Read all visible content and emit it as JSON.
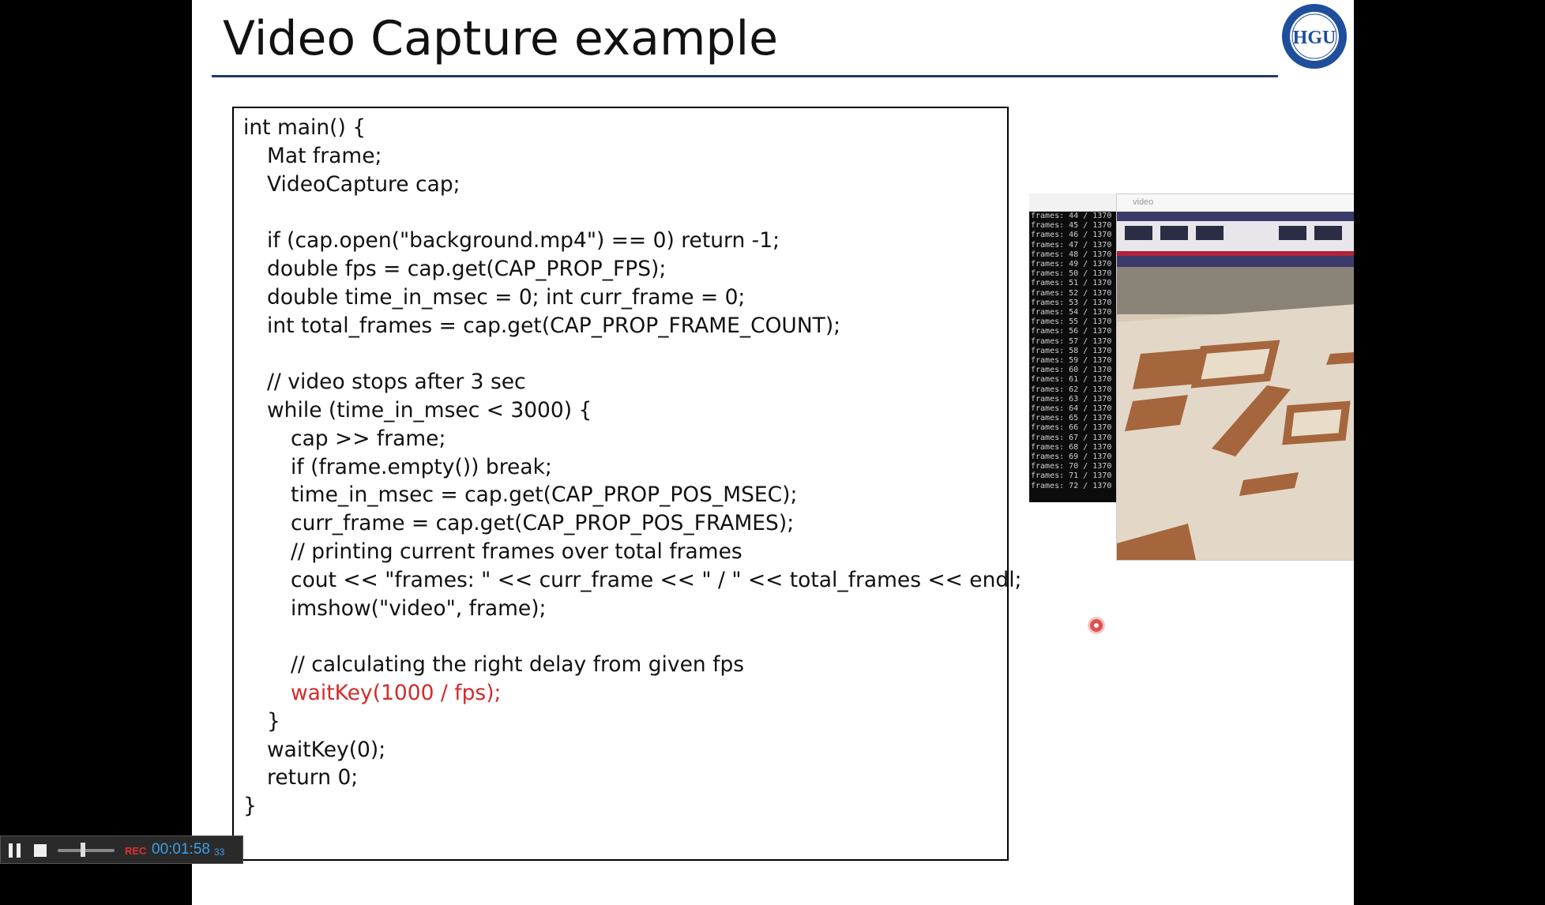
{
  "slide": {
    "title": "Video Capture example",
    "logo_text": "HGU",
    "code_lines": [
      {
        "text": "int main() {",
        "indent": 0,
        "color": "normal"
      },
      {
        "text": "Mat frame;",
        "indent": 1,
        "color": "normal"
      },
      {
        "text": "VideoCapture cap;",
        "indent": 1,
        "color": "normal"
      },
      {
        "text": "",
        "indent": 0,
        "color": "normal"
      },
      {
        "text": "if (cap.open(\"background.mp4\") == 0) return -1;",
        "indent": 1,
        "color": "normal"
      },
      {
        "text": "double fps = cap.get(CAP_PROP_FPS);",
        "indent": 1,
        "color": "normal"
      },
      {
        "text": "double time_in_msec = 0; int curr_frame = 0;",
        "indent": 1,
        "color": "normal"
      },
      {
        "text": "int total_frames = cap.get(CAP_PROP_FRAME_COUNT);",
        "indent": 1,
        "color": "normal"
      },
      {
        "text": "",
        "indent": 0,
        "color": "normal"
      },
      {
        "text": "// video stops after 3 sec",
        "indent": 1,
        "color": "normal"
      },
      {
        "text": "while (time_in_msec < 3000) {",
        "indent": 1,
        "color": "normal"
      },
      {
        "text": "cap >> frame;",
        "indent": 2,
        "color": "normal"
      },
      {
        "text": "if (frame.empty()) break;",
        "indent": 2,
        "color": "normal"
      },
      {
        "text": "time_in_msec = cap.get(CAP_PROP_POS_MSEC);",
        "indent": 2,
        "color": "normal"
      },
      {
        "text": "curr_frame = cap.get(CAP_PROP_POS_FRAMES);",
        "indent": 2,
        "color": "normal"
      },
      {
        "text": "// printing current frames over total frames",
        "indent": 2,
        "color": "normal"
      },
      {
        "text": "cout << \"frames: \" << curr_frame << \" / \" << total_frames << endl;",
        "indent": 2,
        "color": "normal"
      },
      {
        "text": "imshow(\"video\", frame);",
        "indent": 2,
        "color": "normal"
      },
      {
        "text": "",
        "indent": 0,
        "color": "normal"
      },
      {
        "text": "// calculating the right delay from given fps",
        "indent": 2,
        "color": "normal"
      },
      {
        "text": "waitKey(1000 / fps);",
        "indent": 2,
        "color": "red"
      },
      {
        "text": "}",
        "indent": 1,
        "color": "normal"
      },
      {
        "text": "waitKey(0);",
        "indent": 1,
        "color": "normal"
      },
      {
        "text": "return 0;",
        "indent": 1,
        "color": "normal"
      },
      {
        "text": "}",
        "indent": 0,
        "color": "normal"
      }
    ]
  },
  "console_window": {
    "lines": [
      "frames: 44 / 1370",
      "frames: 45 / 1370",
      "frames: 46 / 1370",
      "frames: 47 / 1370",
      "frames: 48 / 1370",
      "frames: 49 / 1370",
      "frames: 50 / 1370",
      "frames: 51 / 1370",
      "frames: 52 / 1370",
      "frames: 53 / 1370",
      "frames: 54 / 1370",
      "frames: 55 / 1370",
      "frames: 56 / 1370",
      "frames: 57 / 1370",
      "frames: 58 / 1370",
      "frames: 59 / 1370",
      "frames: 60 / 1370",
      "frames: 61 / 1370",
      "frames: 62 / 1370",
      "frames: 63 / 1370",
      "frames: 64 / 1370",
      "frames: 65 / 1370",
      "frames: 66 / 1370",
      "frames: 67 / 1370",
      "frames: 68 / 1370",
      "frames: 69 / 1370",
      "frames: 70 / 1370",
      "frames: 71 / 1370",
      "frames: 72 / 1370"
    ]
  },
  "video_window": {
    "title": "video",
    "minimize_glyph": "–",
    "maximize_glyph": "□",
    "close_glyph": "✕"
  },
  "recorder": {
    "rec_label": "REC",
    "time": "00:01:58",
    "time_fraction": "33",
    "progress": 0.45
  },
  "colors": {
    "title_rule": "#1f3b66",
    "code_highlight": "#d42a2a",
    "recorder_time": "#3aa0e8",
    "logo_blue": "#1f4e9c"
  }
}
